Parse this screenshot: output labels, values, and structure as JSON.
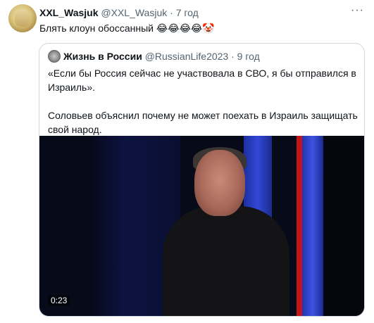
{
  "tweet": {
    "name": "XXL_Wasjuk",
    "handle": "@XXL_Wasjuk",
    "time": "· 7 год",
    "text": "Блять клоун обоссанный 😂😂😂😂🤡",
    "more": "···"
  },
  "quote": {
    "name": "Жизнь в России",
    "handle": "@RussianLife2023",
    "time": "· 9 год",
    "paragraph1": "«Если бы Россия сейчас не участвовала в СВО, я бы отправился в Израиль».",
    "paragraph2": "Соловьев объяснил почему не может поехать в Израиль защищать свой народ.",
    "video_time": "0:23"
  }
}
